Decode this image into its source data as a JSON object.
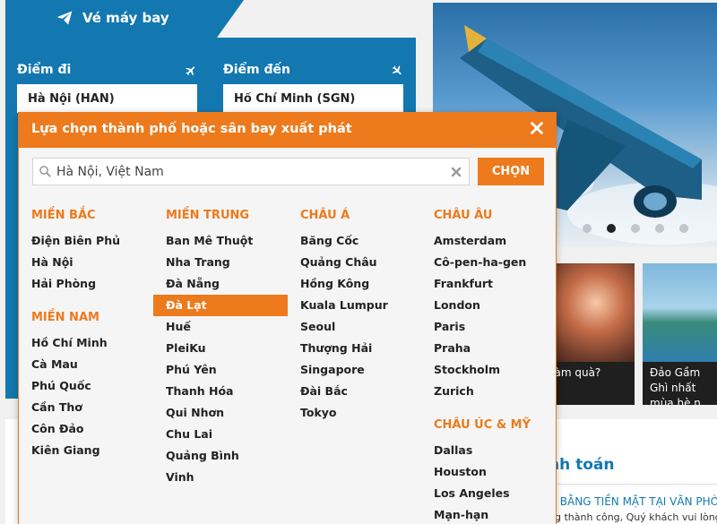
{
  "booking": {
    "tab_title": "Vé máy bay",
    "from_label": "Điểm đi",
    "from_value": "Hà Nội (HAN)",
    "to_label": "Điểm đến",
    "to_value": "Hồ Chí Minh (SGN)"
  },
  "hero": {
    "slide_count": 5,
    "active_slide": 2
  },
  "cards": [
    {
      "text": "i làm quà?"
    },
    {
      "text": "Đảo Gầm Ghì nhất mùa hè n"
    }
  ],
  "payment": {
    "title": "nh toán",
    "heading": "N BẰNG TIỀN MẶT TẠI VĂN PHÒN",
    "body": "ng thành công, Quý khách vui lòng"
  },
  "dropdown": {
    "title": "Lựa chọn thành phố hoặc sân bay xuất phát",
    "search_value": "Hà Nội, Việt Nam",
    "choose_label": "CHỌN",
    "selected_city": "Đà Lạt",
    "columns": [
      {
        "groups": [
          {
            "region": "MIỀN BẮC",
            "cities": [
              "Điện Biên Phủ",
              "Hà Nội",
              "Hải Phòng"
            ]
          },
          {
            "region": "MIỀN NAM",
            "cities": [
              "Hồ Chí Minh",
              "Cà Mau",
              "Phú Quốc",
              "Cần Thơ",
              "Côn Đảo",
              "Kiên Giang"
            ]
          }
        ]
      },
      {
        "groups": [
          {
            "region": "MIỀN TRUNG",
            "cities": [
              "Ban Mê Thuột",
              "Nha Trang",
              "Đà Nẵng",
              "Đà Lạt",
              "Huế",
              "PleiKu",
              "Phú Yên",
              "Thanh Hóa",
              "Qui Nhơn",
              "Chu Lai",
              "Quảng Bình",
              "Vinh"
            ]
          }
        ]
      },
      {
        "groups": [
          {
            "region": "CHÂU Á",
            "cities": [
              "Băng Cốc",
              "Quảng Châu",
              "Hồng Kông",
              "Kuala Lumpur",
              "Seoul",
              "Thượng Hải",
              "Singapore",
              "Đài Bắc",
              "Tokyo"
            ]
          }
        ]
      },
      {
        "groups": [
          {
            "region": "CHÂU ÂU",
            "cities": [
              "Amsterdam",
              "Cô-pen-ha-gen",
              "Frankfurt",
              "London",
              "Paris",
              "Praha",
              "Stockholm",
              "Zurich"
            ]
          },
          {
            "region": "CHÂU ÚC & MỸ",
            "cities": [
              "Dallas",
              "Houston",
              "Los Angeles",
              "Mạn-hạn"
            ]
          }
        ]
      }
    ]
  }
}
